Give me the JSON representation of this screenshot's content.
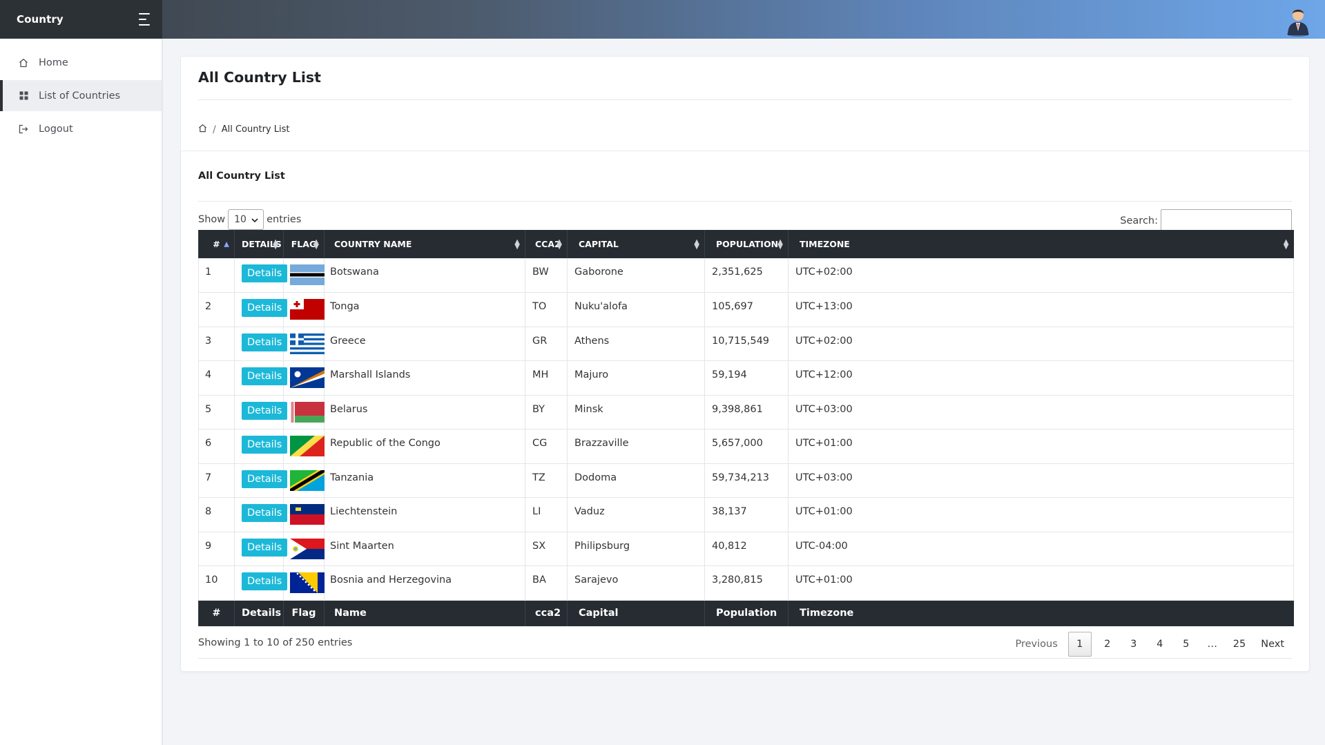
{
  "brand": {
    "name": "Country"
  },
  "sidebar": {
    "items": [
      {
        "label": "Home",
        "icon": "home-icon"
      },
      {
        "label": "List of Countries",
        "icon": "grid-icon"
      },
      {
        "label": "Logout",
        "icon": "logout-icon"
      }
    ]
  },
  "header": {
    "title": "All Country List",
    "breadcrumb": "All Country List"
  },
  "table_card": {
    "title": "All Country List",
    "show_label": "Show",
    "entries_label": "entries",
    "length_value": "10",
    "search_label": "Search:",
    "search_value": ""
  },
  "columns": [
    "#",
    "DETAILS",
    "FLAG",
    "COUNTRY NAME",
    "CCA2",
    "CAPITAL",
    "POPULATION",
    "TIMEZONE"
  ],
  "footer_columns": [
    "#",
    "Details",
    "Flag",
    "Name",
    "cca2",
    "Capital",
    "Population",
    "Timezone"
  ],
  "details_label": "Details",
  "rows": [
    {
      "num": "1",
      "name": "Botswana",
      "cca2": "BW",
      "capital": "Gaborone",
      "population": "2,351,625",
      "timezone": "UTC+02:00"
    },
    {
      "num": "2",
      "name": "Tonga",
      "cca2": "TO",
      "capital": "Nuku'alofa",
      "population": "105,697",
      "timezone": "UTC+13:00"
    },
    {
      "num": "3",
      "name": "Greece",
      "cca2": "GR",
      "capital": "Athens",
      "population": "10,715,549",
      "timezone": "UTC+02:00"
    },
    {
      "num": "4",
      "name": "Marshall Islands",
      "cca2": "MH",
      "capital": "Majuro",
      "population": "59,194",
      "timezone": "UTC+12:00"
    },
    {
      "num": "5",
      "name": "Belarus",
      "cca2": "BY",
      "capital": "Minsk",
      "population": "9,398,861",
      "timezone": "UTC+03:00"
    },
    {
      "num": "6",
      "name": "Republic of the Congo",
      "cca2": "CG",
      "capital": "Brazzaville",
      "population": "5,657,000",
      "timezone": "UTC+01:00"
    },
    {
      "num": "7",
      "name": "Tanzania",
      "cca2": "TZ",
      "capital": "Dodoma",
      "population": "59,734,213",
      "timezone": "UTC+03:00"
    },
    {
      "num": "8",
      "name": "Liechtenstein",
      "cca2": "LI",
      "capital": "Vaduz",
      "population": "38,137",
      "timezone": "UTC+01:00"
    },
    {
      "num": "9",
      "name": "Sint Maarten",
      "cca2": "SX",
      "capital": "Philipsburg",
      "population": "40,812",
      "timezone": "UTC-04:00"
    },
    {
      "num": "10",
      "name": "Bosnia and Herzegovina",
      "cca2": "BA",
      "capital": "Sarajevo",
      "population": "3,280,815",
      "timezone": "UTC+01:00"
    }
  ],
  "info": "Showing 1 to 10 of 250 entries",
  "pagination": {
    "previous": "Previous",
    "pages": [
      "1",
      "2",
      "3",
      "4",
      "5",
      "…",
      "25"
    ],
    "current": "1",
    "next": "Next"
  },
  "colors": {
    "accent": "#1cb8d8",
    "table_header": "#262c32",
    "brand_bg": "#2c3136"
  }
}
